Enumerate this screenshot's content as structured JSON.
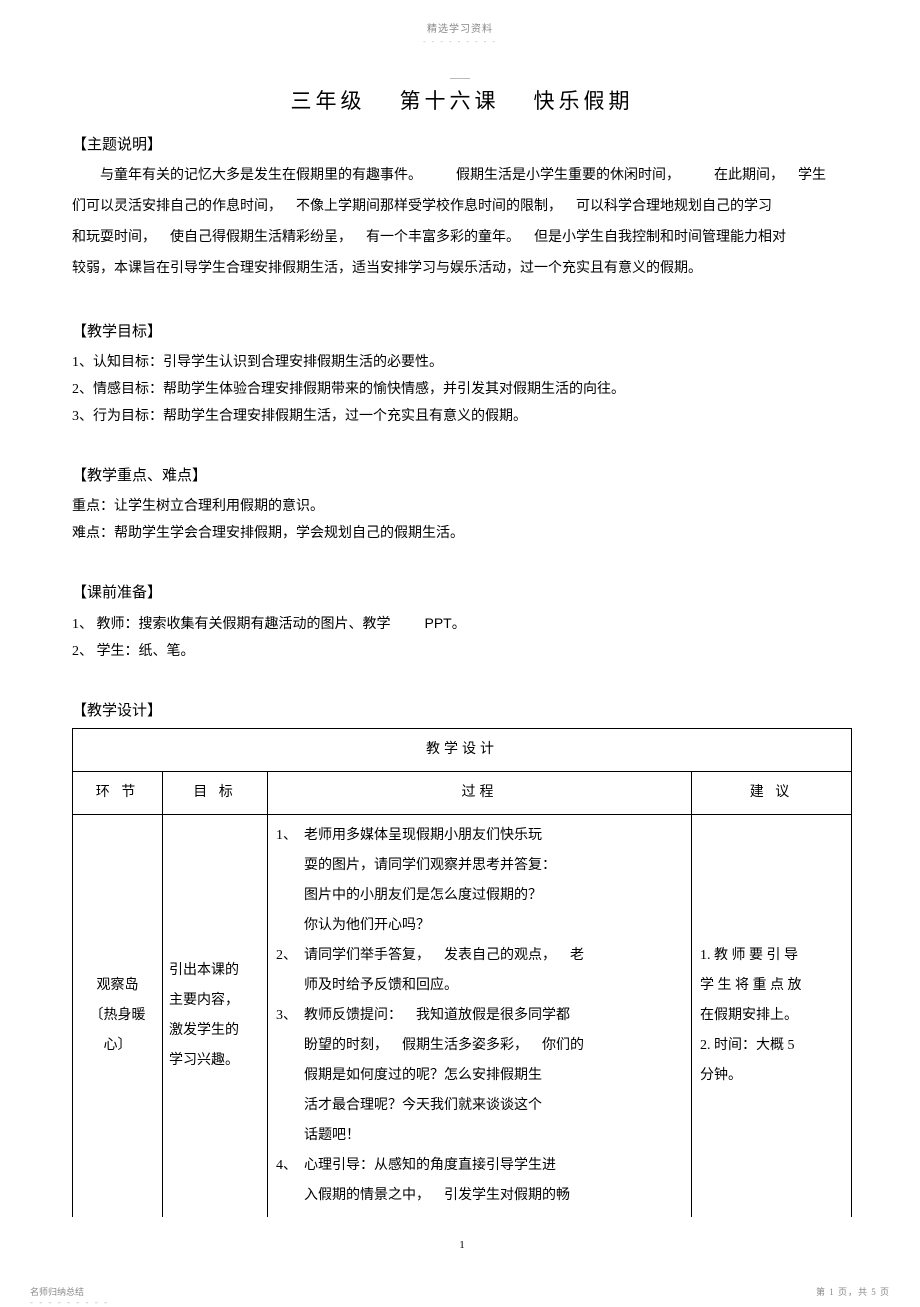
{
  "header_small": "精选学习资料",
  "header_dashes": "- - - - - - - - -",
  "title_grade": "三年级",
  "title_lesson": "第十六课",
  "title_name": "快乐假期",
  "s1_head": "【主题说明】",
  "s1_p1a": "与童年有关的记忆大多是发生在假期里的有趣事件。",
  "s1_p1b": "假期生活是小学生重要的休闲时间，",
  "s1_p1c": "在此期间，",
  "s1_p1d": "学生",
  "s1_p2a": "们可以灵活安排自己的作息时间，",
  "s1_p2b": "不像上学期间那样受学校作息时间的限制，",
  "s1_p2c": "可以科学合理地规划自己的学习",
  "s1_p3a": "和玩耍时间，",
  "s1_p3b": "使自己得假期生活精彩纷呈，",
  "s1_p3c": "有一个丰富多彩的童年。",
  "s1_p3d": "但是小学生自我控制和时间管理能力相对",
  "s1_p4": "较弱，本课旨在引导学生合理安排假期生活，适当安排学习与娱乐活动，过一个充实且有意义的假期。",
  "s2_head": "【教学目标】",
  "s2_l1": "1、认知目标：引导学生认识到合理安排假期生活的必要性。",
  "s2_l2": "2、情感目标：帮助学生体验合理安排假期带来的愉快情感，并引发其对假期生活的向往。",
  "s2_l3": "3、行为目标：帮助学生合理安排假期生活，过一个充实且有意义的假期。",
  "s3_head": "【教学重点、难点】",
  "s3_l1": "重点：让学生树立合理利用假期的意识。",
  "s3_l2": "难点：帮助学生学会合理安排假期，学会规划自己的假期生活。",
  "s4_head": "【课前准备】",
  "s4_l1a": "1、 教师：搜索收集有关假期有趣活动的图片、教学",
  "s4_l1b": "PPT",
  "s4_l1c": "。",
  "s4_l2": "2、 学生：纸、笔。",
  "s5_head": "【教学设计】",
  "tbl_title": "教学设计",
  "th_step": "环  节",
  "th_goal": "目  标",
  "th_proc": "过程",
  "th_sug": "建  议",
  "row1_step_a": "观察岛",
  "row1_step_b": "〔热身暖",
  "row1_step_c": "心〕",
  "row1_goal_a": "引出本课的",
  "row1_goal_b": "主要内容，",
  "row1_goal_c": "激发学生的",
  "row1_goal_d": "学习兴趣。",
  "proc_1n": "1、",
  "proc_1a": "老师用多媒体呈现假期小朋友们快乐玩",
  "proc_1b": "耍的图片，请同学们观察并思考并答复：",
  "proc_1c": "图片中的小朋友们是怎么度过假期的？",
  "proc_1d": "你认为他们开心吗？",
  "proc_2n": "2、",
  "proc_2a1": "请同学们举手答复，",
  "proc_2a2": "发表自己的观点，",
  "proc_2a3": "老",
  "proc_2b": "师及时给予反馈和回应。",
  "proc_3n": "3、",
  "proc_3a1": "教师反馈提问：",
  "proc_3a2": "我知道放假是很多同学都",
  "proc_3b1": "盼望的时刻，",
  "proc_3b2": "假期生活多姿多彩，",
  "proc_3b3": "你们的",
  "proc_3c": "假期是如何度过的呢？怎么安排假期生",
  "proc_3d": "活才最合理呢？今天我们就来谈谈这个",
  "proc_3e": "话题吧！",
  "proc_4n": "4、",
  "proc_4a": "心理引导：从感知的角度直接引导学生进",
  "proc_4b1": "入假期的情景之中，",
  "proc_4b2": "引发学生对假期的畅",
  "sug_1a": "1. 教 师 要 引  导",
  "sug_1b": "学 生 将 重 点  放",
  "sug_1c": "在假期安排上。",
  "sug_2a": "2. 时间：大概  5",
  "sug_2b": "分钟。",
  "page_num": "1",
  "footer_left": "名师归纳总结",
  "footer_dashes": "- - - - - - - - -",
  "footer_right": "第 1 页，共 5 页"
}
